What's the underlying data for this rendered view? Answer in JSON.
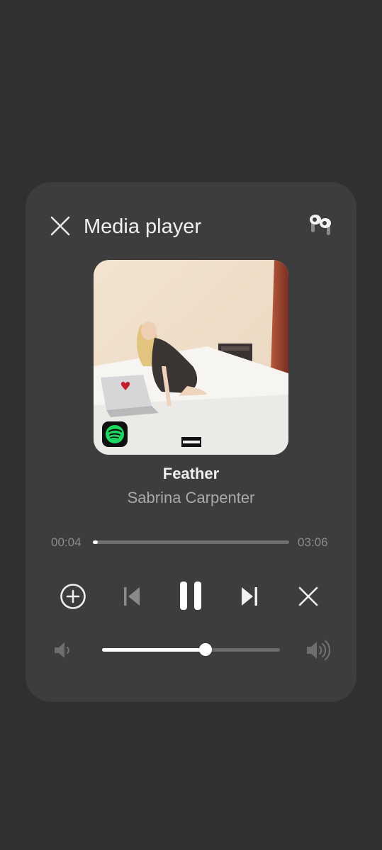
{
  "header": {
    "title": "Media player",
    "close_icon": "close-icon",
    "device_icon": "earbuds-icon"
  },
  "track": {
    "title": "Feather",
    "artist": "Sabrina Carpenter",
    "album_badges": [
      "spotify-logo",
      "parental-advisory-label"
    ]
  },
  "progress": {
    "current": "00:04",
    "total": "03:06",
    "fraction": 0.02
  },
  "controls": [
    {
      "name": "add-button",
      "icon": "plus-circle-icon",
      "enabled": true
    },
    {
      "name": "previous-button",
      "icon": "skip-previous-icon",
      "enabled": false
    },
    {
      "name": "pause-button",
      "icon": "pause-icon",
      "enabled": true
    },
    {
      "name": "next-button",
      "icon": "skip-next-icon",
      "enabled": true
    },
    {
      "name": "dismiss-button",
      "icon": "close-icon",
      "enabled": true
    }
  ],
  "volume": {
    "level": 0.58,
    "low_icon": "volume-low-icon",
    "high_icon": "volume-high-icon"
  },
  "colors": {
    "background": "#303030",
    "panel": "#3d3d3d",
    "accent_spotify": "#1ed760"
  }
}
